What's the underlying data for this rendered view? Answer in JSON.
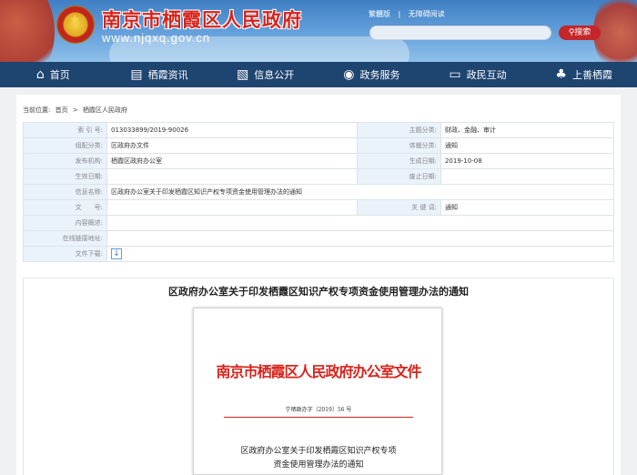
{
  "header": {
    "site_name": "南京市栖霞区人民政府",
    "site_url": "www.njqxq.gov.cn",
    "link_traditional": "繁體版",
    "link_accessible": "无障碍阅读",
    "search_placeholder": "",
    "search_label": "搜索"
  },
  "nav": [
    {
      "label": "首页",
      "icon": "home-icon",
      "glyph": "⌂"
    },
    {
      "label": "栖霞资讯",
      "icon": "news-icon",
      "glyph": "▤"
    },
    {
      "label": "信息公开",
      "icon": "document-icon",
      "glyph": "▧"
    },
    {
      "label": "政务服务",
      "icon": "service-icon",
      "glyph": "◉"
    },
    {
      "label": "政民互动",
      "icon": "chat-icon",
      "glyph": "▭"
    },
    {
      "label": "上善栖霞",
      "icon": "leaf-icon",
      "glyph": "♣"
    }
  ],
  "breadcrumb": {
    "prefix": "当前位置:",
    "home": "首页",
    "sep": ">",
    "current": "栖霞区人民政府"
  },
  "info": {
    "index_label": "索 引 号:",
    "index_value": "013033899/2019-90026",
    "topic_label": "主题分类:",
    "topic_value": "财政、金融、审计",
    "org_cat_label": "组配分类:",
    "org_cat_value": "区政府办文件",
    "genre_label": "体裁分类:",
    "genre_value": "通知",
    "publisher_label": "发布机构:",
    "publisher_value": "栖霞区政府办公室",
    "created_label": "生成日期:",
    "created_value": "2019-10-08",
    "effective_label": "生效日期:",
    "effective_value": "",
    "abolish_label": "废止日期:",
    "abolish_value": "",
    "title_label": "信息名称:",
    "title_value": "区政府办公室关于印发栖霞区知识产权专项资金使用管理办法的通知",
    "docno_label": "文　　号:",
    "docno_value": "",
    "keywords_label": "关 键 词:",
    "keywords_value": "通知",
    "summary_label": "内容概述:",
    "summary_value": "",
    "link_label": "在线链接地址:",
    "link_value": "",
    "download_label": "文件下载:"
  },
  "document": {
    "title": "区政府办公室关于印发栖霞区知识产权专项资金使用管理办法的通知",
    "paper_header": "南京市栖霞区人民政府办公室文件",
    "paper_number": "宁栖政办字〔2019〕56 号",
    "paper_title_line1": "区政府办公室关于印发栖霞区知识产权专项",
    "paper_title_line2": "资金使用管理办法的通知"
  },
  "colors": {
    "nav_bg": "#1e4470",
    "accent_red": "#d8231b",
    "label_bg": "#eaf2fa"
  }
}
